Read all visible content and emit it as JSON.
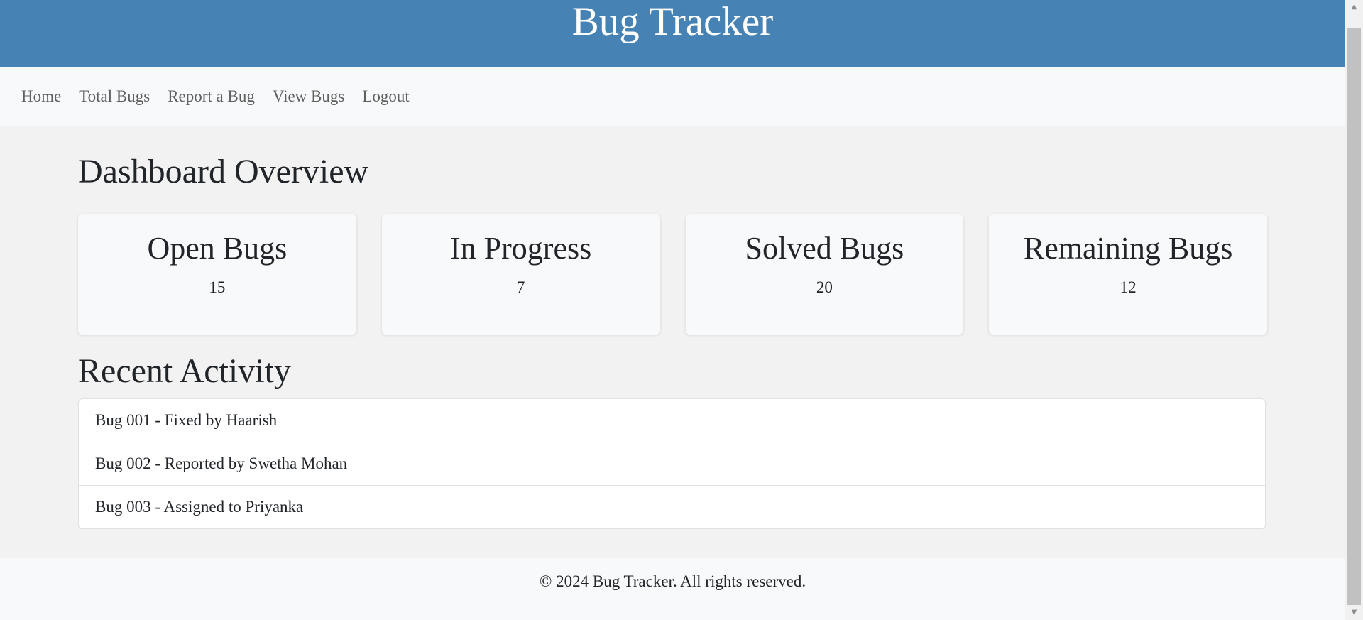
{
  "header": {
    "title": "Bug Tracker"
  },
  "nav": {
    "items": [
      {
        "label": "Home"
      },
      {
        "label": "Total Bugs"
      },
      {
        "label": "Report a Bug"
      },
      {
        "label": "View Bugs"
      },
      {
        "label": "Logout"
      }
    ]
  },
  "dashboard": {
    "title": "Dashboard Overview",
    "cards": [
      {
        "title": "Open Bugs",
        "value": "15"
      },
      {
        "title": "In Progress",
        "value": "7"
      },
      {
        "title": "Solved Bugs",
        "value": "20"
      },
      {
        "title": "Remaining Bugs",
        "value": "12"
      }
    ]
  },
  "activity": {
    "title": "Recent Activity",
    "items": [
      "Bug 001 - Fixed by Haarish",
      "Bug 002 - Reported by Swetha Mohan",
      "Bug 003 - Assigned to Priyanka"
    ]
  },
  "footer": {
    "text": "© 2024 Bug Tracker. All rights reserved."
  },
  "scrollbar": {
    "up_icon": "▲",
    "down_icon": "▼"
  },
  "colors": {
    "header_bg": "#4682b4",
    "nav_bg": "#f8f9fa",
    "page_bg": "#f2f2f2"
  }
}
